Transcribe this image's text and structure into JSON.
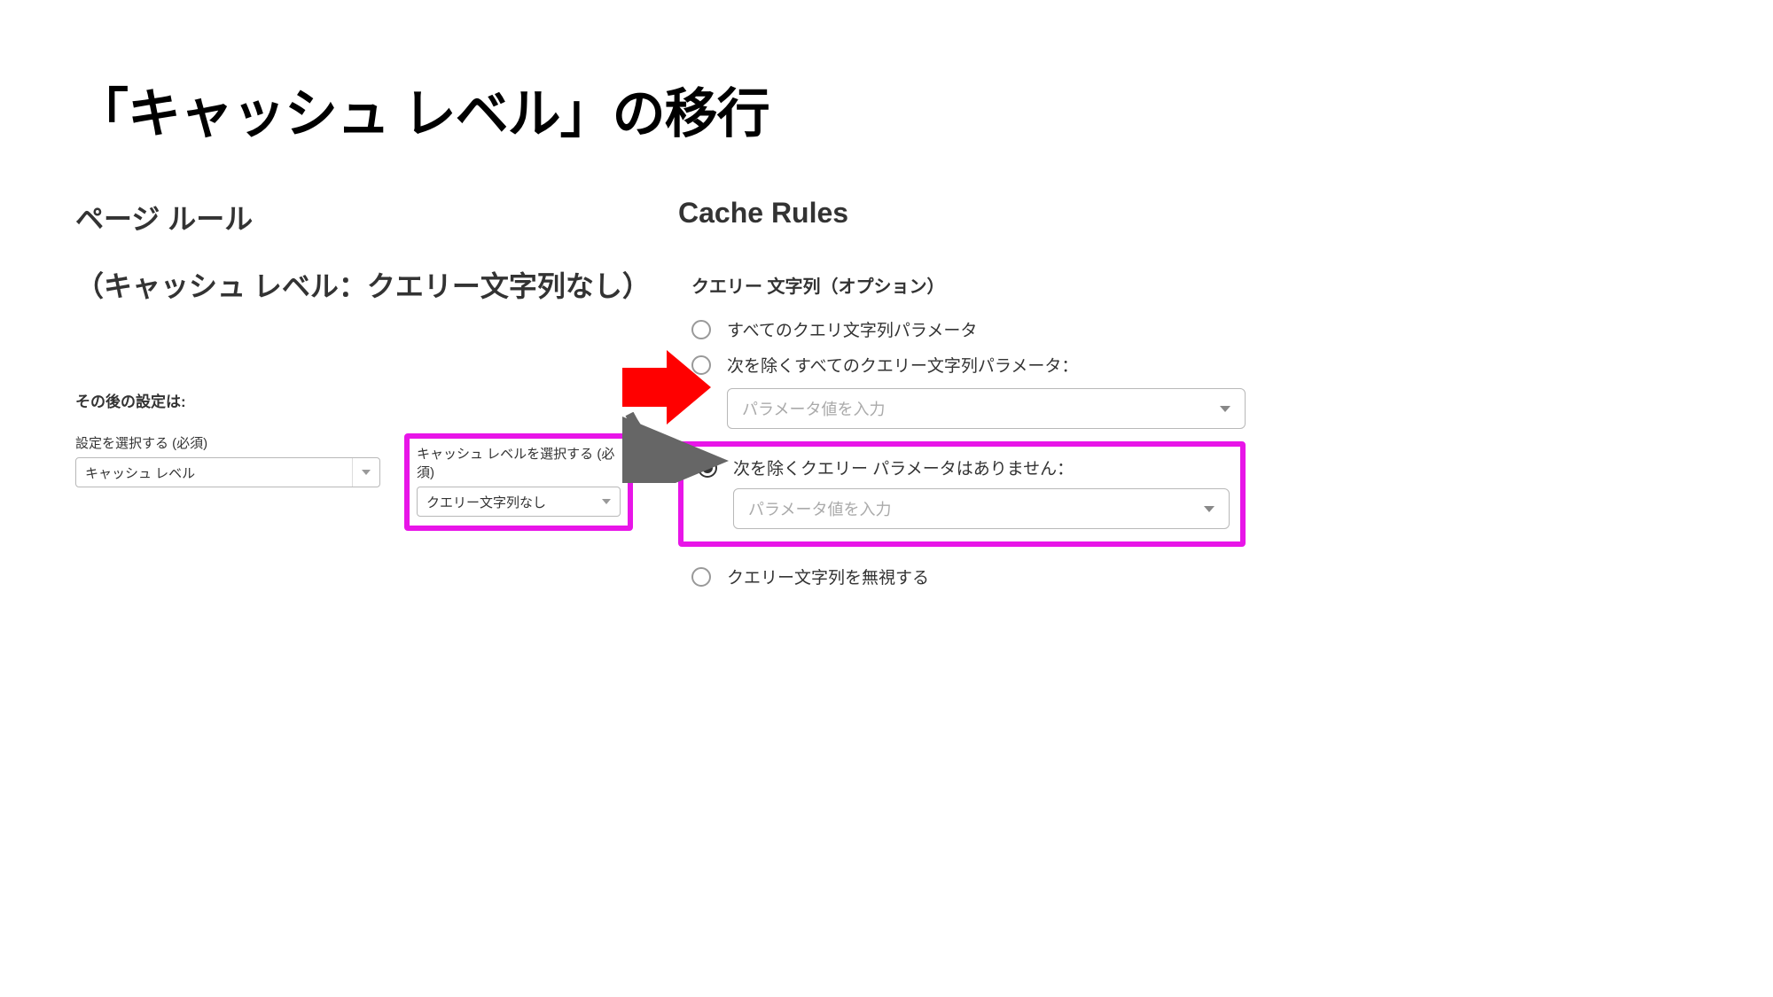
{
  "title": "「キャッシュ レベル」の移行",
  "left": {
    "heading": "ページ ルール",
    "subheading": "（キャッシュ レベル：クエリー文字列なし）",
    "settings_label": "その後の設定は:",
    "select_setting": {
      "label": "設定を選択する (必須)",
      "value": "キャッシュ レベル"
    },
    "select_cache_level": {
      "label": "キャッシュ レベルを選択する (必須)",
      "value": "クエリー文字列なし"
    }
  },
  "right": {
    "heading": "Cache Rules",
    "query_string_label": "クエリー 文字列（オプション）",
    "options": {
      "all": "すべてのクエリ文字列パラメータ",
      "all_except": "次を除くすべてのクエリー文字列パラメータ：",
      "none_except": "次を除くクエリー パラメータはありません：",
      "ignore": "クエリー文字列を無視する"
    },
    "param_placeholder": "パラメータ値を入力"
  }
}
